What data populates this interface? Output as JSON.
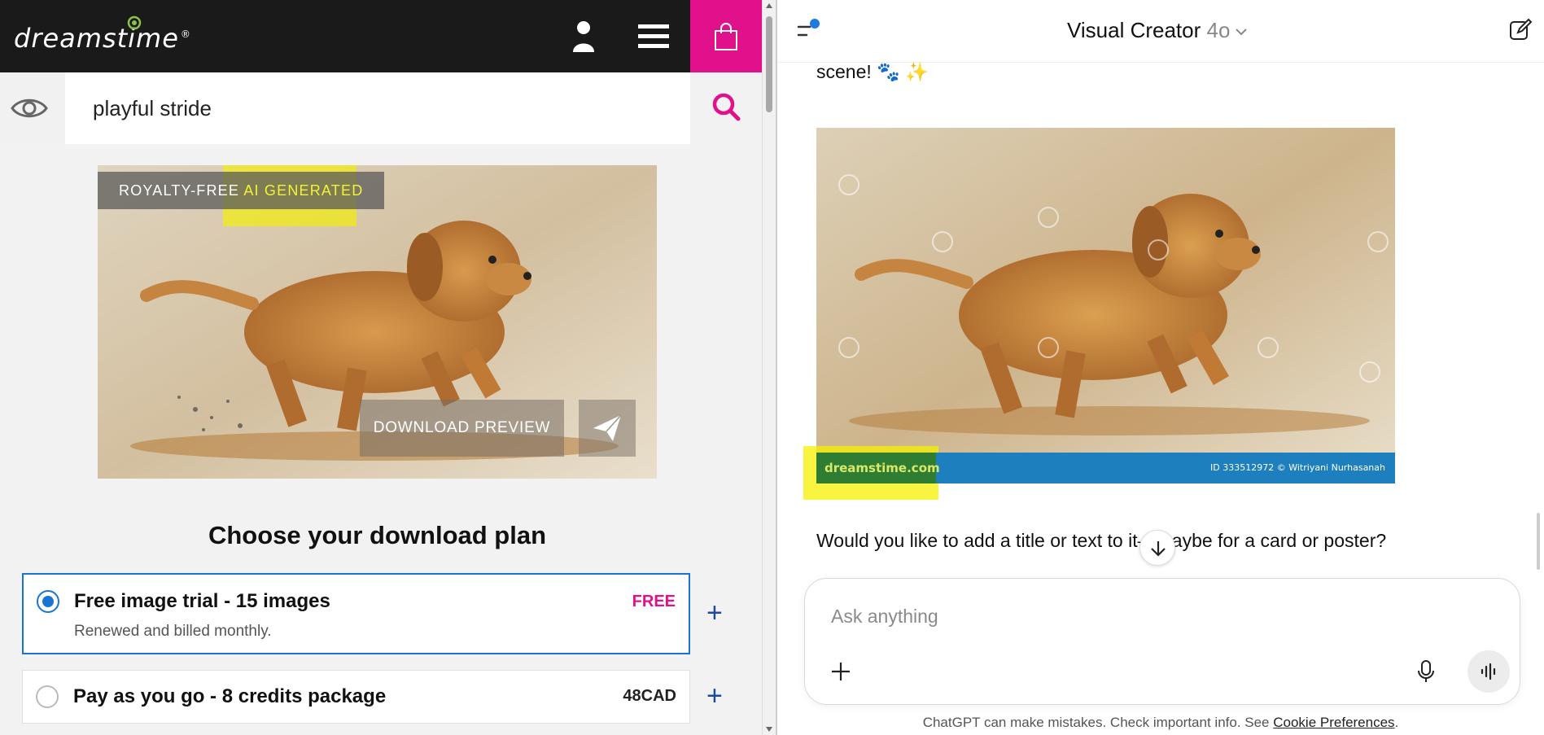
{
  "left_pane": {
    "header": {
      "logo_text": "dreamstime",
      "logo_mark": "®",
      "icons": [
        "user-icon",
        "menu-icon",
        "shopping-bag-icon"
      ],
      "accent_color": "#e0118a"
    },
    "search": {
      "value": "playful stride",
      "icons": [
        "eye-icon",
        "search-icon"
      ]
    },
    "preview": {
      "badge_prefix": "ROYALTY-FREE ",
      "badge_highlight": "AI GENERATED",
      "download_label": "DOWNLOAD PREVIEW",
      "share_icon": "paper-plane-icon"
    },
    "plans": {
      "title": "Choose your download plan",
      "items": [
        {
          "name": "Free image trial - 15 images",
          "subtitle": "Renewed and billed monthly.",
          "price": "FREE",
          "selected": true
        },
        {
          "name": "Pay as you go - 8 credits package",
          "subtitle": "",
          "price": "48CAD",
          "selected": false
        }
      ],
      "expand_label": "+"
    }
  },
  "right_pane": {
    "header": {
      "model_name": "Visual Creator",
      "model_version": "4o",
      "icons": [
        "sidebar-toggle-icon",
        "chevron-down-icon",
        "new-chat-icon"
      ]
    },
    "messages": {
      "top_text": "scene! 🐾 ✨",
      "image_watermark_domain": "dreamstime.com",
      "image_watermark_id": "ID 333512972 © Witriyani Nurhasanah",
      "bottom_text": "Would you like to add a title or text to it—maybe for a card or poster?"
    },
    "composer": {
      "placeholder": "Ask anything",
      "icons": [
        "plus-icon",
        "microphone-icon",
        "voice-mode-icon"
      ]
    },
    "disclaimer": {
      "text": "ChatGPT can make mistakes. Check important info. See ",
      "link": "Cookie Preferences",
      "suffix": "."
    }
  }
}
